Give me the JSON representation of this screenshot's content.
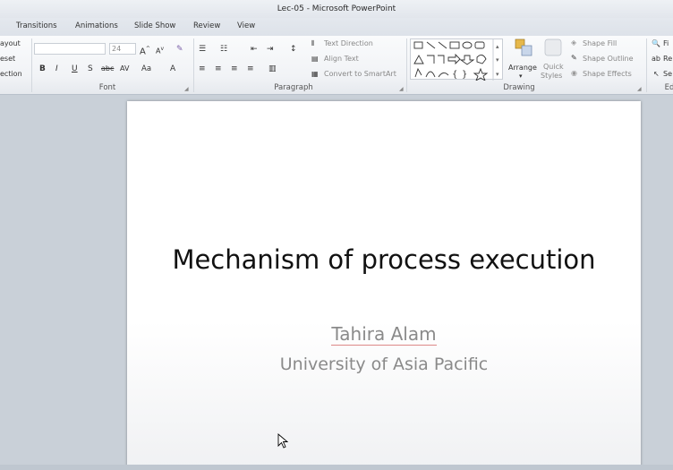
{
  "window": {
    "title": "Lec-05 - Microsoft PowerPoint"
  },
  "tabs": [
    "Transitions",
    "Animations",
    "Slide Show",
    "Review",
    "View"
  ],
  "ribbon": {
    "slides_group": {
      "layout": "ayout",
      "reset": "eset",
      "section": "ection"
    },
    "font_group": {
      "label": "Font",
      "font_size": "24",
      "bold": "B",
      "italic": "I",
      "underline": "U",
      "shadow": "S",
      "strike": "abc",
      "spacing": "AV",
      "case": "Aa",
      "color": "A"
    },
    "paragraph_group": {
      "label": "Paragraph",
      "text_direction": "Text Direction",
      "align_text": "Align Text",
      "convert_smartart": "Convert to SmartArt"
    },
    "drawing_group": {
      "label": "Drawing",
      "arrange": "Arrange",
      "quick_styles_1": "Quick",
      "quick_styles_2": "Styles",
      "shape_fill": "Shape Fill",
      "shape_outline": "Shape Outline",
      "shape_effects": "Shape Effects"
    },
    "editing_group": {
      "find": "Fi",
      "replace": "Re",
      "select": "Se",
      "label": "Ed"
    }
  },
  "slide": {
    "title": "Mechanism of process execution",
    "author": "Tahira Alam",
    "institution": "University of Asia Pacific"
  }
}
